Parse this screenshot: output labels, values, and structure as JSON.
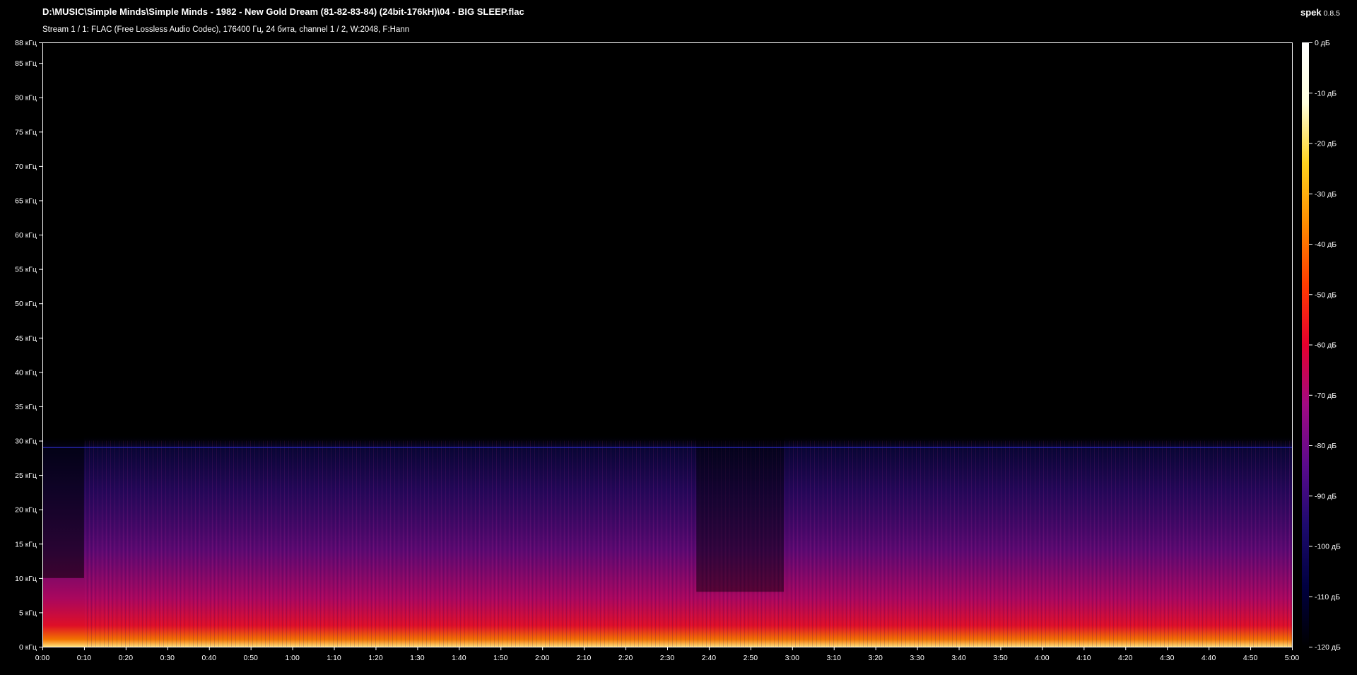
{
  "header": {
    "file_path": "D:\\MUSIC\\Simple Minds\\Simple Minds - 1982 - New Gold Dream (81-82-83-84) (24bit-176kH)\\04 - BIG SLEEP.flac",
    "stream_info": "Stream 1 / 1: FLAC (Free Lossless Audio Codec), 176400 Гц, 24 бита, channel 1 / 2, W:2048, F:Hann",
    "app_name": "spek",
    "app_version": "0.8.5"
  },
  "colors": {
    "background": "#000000",
    "text": "#ffffff",
    "colormap": [
      "#000000",
      "#000040",
      "#1c0a6e",
      "#5a0a8c",
      "#a00a82",
      "#e6002d",
      "#ff3c00",
      "#ff8c00",
      "#ffd21e",
      "#ffffdc",
      "#ffffff"
    ]
  },
  "chart_data": {
    "type": "heatmap",
    "x_axis": {
      "unit": "time",
      "range_seconds": [
        0,
        300
      ],
      "tick_labels": [
        "0:00",
        "0:10",
        "0:20",
        "0:30",
        "0:40",
        "0:50",
        "1:00",
        "1:10",
        "1:20",
        "1:30",
        "1:40",
        "1:50",
        "2:00",
        "2:10",
        "2:20",
        "2:30",
        "2:40",
        "2:50",
        "3:00",
        "3:10",
        "3:20",
        "3:30",
        "3:40",
        "3:50",
        "4:00",
        "4:10",
        "4:20",
        "4:30",
        "4:40",
        "4:50",
        "5:00"
      ]
    },
    "y_axis": {
      "unit": "kHz",
      "range": [
        0,
        88
      ],
      "ticks": [
        0,
        5,
        10,
        15,
        20,
        25,
        30,
        35,
        40,
        45,
        50,
        55,
        60,
        65,
        70,
        75,
        80,
        85,
        88
      ],
      "tick_labels": [
        "0 кГц",
        "5 кГц",
        "10 кГц",
        "15 кГц",
        "20 кГц",
        "25 кГц",
        "30 кГц",
        "35 кГц",
        "40 кГц",
        "45 кГц",
        "50 кГц",
        "55 кГц",
        "60 кГц",
        "65 кГц",
        "70 кГц",
        "75 кГц",
        "80 кГц",
        "85 кГц",
        "88 кГц"
      ]
    },
    "color_scale": {
      "unit": "dB",
      "range": [
        -120,
        0
      ],
      "ticks": [
        0,
        -10,
        -20,
        -30,
        -40,
        -50,
        -60,
        -70,
        -80,
        -90,
        -100,
        -110,
        -120
      ],
      "tick_labels": [
        "0 дБ",
        "-10 дБ",
        "-20 дБ",
        "-30 дБ",
        "-40 дБ",
        "-50 дБ",
        "-60 дБ",
        "-70 дБ",
        "-80 дБ",
        "-90 дБ",
        "-100 дБ",
        "-110 дБ",
        "-120 дБ"
      ]
    },
    "observed_features": {
      "content_cutoff_khz": 30,
      "persistent_tone_khz": 29,
      "quiet_intro_end_seconds": 10,
      "quiet_section_seconds": [
        157,
        178
      ]
    }
  }
}
